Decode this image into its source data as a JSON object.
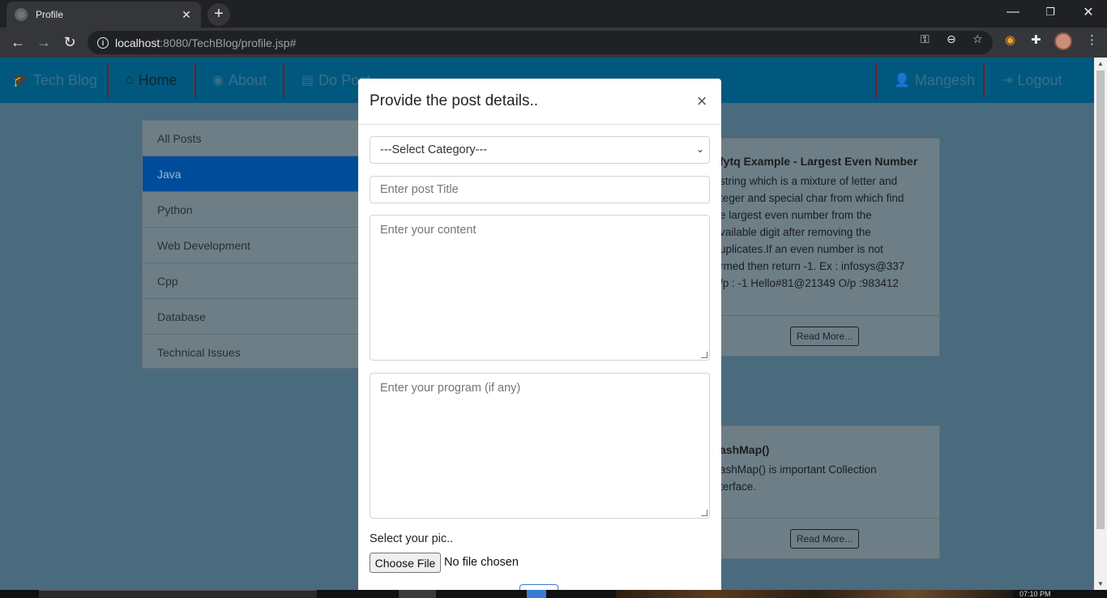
{
  "browser": {
    "tab_title": "Profile",
    "url_host": "localhost",
    "url_rest": ":8080/TechBlog/profile.jsp#"
  },
  "navbar": {
    "brand": "Tech Blog",
    "home": "Home",
    "about": "About",
    "do_post": "Do Post",
    "user": "Mangesh",
    "logout": "Logout"
  },
  "sidebar": {
    "items": [
      {
        "label": "All Posts"
      },
      {
        "label": "Java",
        "active": true
      },
      {
        "label": "Python"
      },
      {
        "label": "Web Development"
      },
      {
        "label": "Cpp"
      },
      {
        "label": "Database"
      },
      {
        "label": "Technical Issues"
      }
    ]
  },
  "posts": [
    {
      "title": "fytq Example - Largest Even Number",
      "lines": [
        "string which is a mixture of letter and",
        "teger and special char from which find",
        "e largest even number from the",
        "vailable digit after removing the",
        "uplicates.If an even number is not",
        "rmed then return -1. Ex : infosys@337",
        "/p : -1 Hello#81@21349 O/p :983412"
      ],
      "button": "Read More..."
    },
    {
      "title": "ashMap()",
      "lines": [
        "ashMap() is important Collection",
        "terface."
      ],
      "button": "Read More..."
    }
  ],
  "modal": {
    "title": "Provide the post details..",
    "close": "×",
    "category_selected": "---Select Category---",
    "title_placeholder": "Enter post Title",
    "content_placeholder": "Enter your content",
    "program_placeholder": "Enter your program (if any)",
    "pic_label": "Select your pic..",
    "file_button": "Choose File",
    "file_status": "No file chosen"
  },
  "taskbar": {
    "clock": "07:10 PM"
  },
  "colors": {
    "navbar": "#00587f",
    "active_item": "#004c9a",
    "page_overlay": "#4a6a7d"
  }
}
